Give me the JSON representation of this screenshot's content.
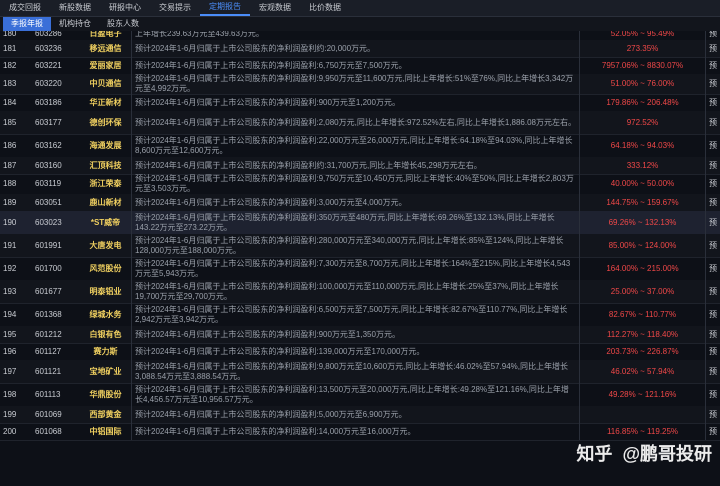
{
  "topnav": {
    "tabs": [
      "成交回报",
      "新股数据",
      "研报中心",
      "交易提示",
      "定期报告",
      "宏观数据",
      "比价数据"
    ],
    "active_index": 4
  },
  "subnav": {
    "tabs": [
      "季报年报",
      "机构持仓",
      "股东人数"
    ],
    "active_index": 0
  },
  "rows": [
    {
      "idx": "180",
      "code": "603286",
      "name": "日盈电子",
      "desc": "上年增长239.63万元至439.63万元。",
      "range": "52.05% ~ 95.49%",
      "type": "预"
    },
    {
      "idx": "181",
      "code": "603236",
      "name": "移远通信",
      "desc": "预计2024年1-6月归属于上市公司股东的净利润盈利约:20,000万元。",
      "range": "273.35%",
      "type": "预"
    },
    {
      "idx": "182",
      "code": "603221",
      "name": "爱丽家居",
      "desc": "预计2024年1-6月归属于上市公司股东的净利润盈利:6,750万元至7,500万元。",
      "range": "7957.06% ~ 8830.07%",
      "type": "预"
    },
    {
      "idx": "183",
      "code": "603220",
      "name": "中贝通信",
      "desc": "预计2024年1-6月归属于上市公司股东的净利润盈利:9,950万元至11,600万元,同比上年增长:51%至76%,同比上年增长3,342万元至4,992万元。",
      "range": "51.00% ~ 76.00%",
      "type": "预"
    },
    {
      "idx": "184",
      "code": "603186",
      "name": "华正新材",
      "desc": "预计2024年1-6月归属于上市公司股东的净利润盈利:900万元至1,200万元。",
      "range": "179.86% ~ 206.48%",
      "type": "预"
    },
    {
      "idx": "185",
      "code": "603177",
      "name": "德创环保",
      "desc": "预计2024年1-6月归属于上市公司股东的净利润盈利:2,080万元,同比上年增长:972.52%左右,同比上年增长1,886.08万元左右。",
      "range": "972.52%",
      "type": "预"
    },
    {
      "idx": "186",
      "code": "603162",
      "name": "海通发展",
      "desc": "预计2024年1-6月归属于上市公司股东的净利润盈利:22,000万元至26,000万元,同比上年增长:64.18%至94.03%,同比上年增长8,600万元至12,600万元。",
      "range": "64.18% ~ 94.03%",
      "type": "预"
    },
    {
      "idx": "187",
      "code": "603160",
      "name": "汇顶科技",
      "desc": "预计2024年1-6月归属于上市公司股东的净利润盈利约:31,700万元,同比上年增长45,298万元左右。",
      "range": "333.12%",
      "type": "预"
    },
    {
      "idx": "188",
      "code": "603119",
      "name": "浙江荣泰",
      "desc": "预计2024年1-6月归属于上市公司股东的净利润盈利:9,750万元至10,450万元,同比上年增长:40%至50%,同比上年增长2,803万元至3,503万元。",
      "range": "40.00% ~ 50.00%",
      "type": "预"
    },
    {
      "idx": "189",
      "code": "603051",
      "name": "鹿山新材",
      "desc": "预计2024年1-6月归属于上市公司股东的净利润盈利:3,000万元至4,000万元。",
      "range": "144.75% ~ 159.67%",
      "type": "预"
    },
    {
      "idx": "190",
      "code": "603023",
      "name": "*ST威帝",
      "desc": "预计2024年1-6月归属于上市公司股东的净利润盈利:350万元至480万元,同比上年增长:69.26%至132.13%,同比上年增长143.22万元至273.22万元。",
      "range": "69.26% ~ 132.13%",
      "type": "预"
    },
    {
      "idx": "191",
      "code": "601991",
      "name": "大唐发电",
      "desc": "预计2024年1-6月归属于上市公司股东的净利润盈利:280,000万元至340,000万元,同比上年增长:85%至124%,同比上年增长128,000万元至188,000万元。",
      "range": "85.00% ~ 124.00%",
      "type": "预"
    },
    {
      "idx": "192",
      "code": "601700",
      "name": "风范股份",
      "desc": "预计2024年1-6月归属于上市公司股东的净利润盈利:7,300万元至8,700万元,同比上年增长:164%至215%,同比上年增长4,543万元至5,943万元。",
      "range": "164.00% ~ 215.00%",
      "type": "预"
    },
    {
      "idx": "193",
      "code": "601677",
      "name": "明泰铝业",
      "desc": "预计2024年1-6月归属于上市公司股东的净利润盈利:100,000万元至110,000万元,同比上年增长:25%至37%,同比上年增长19,700万元至29,700万元。",
      "range": "25.00% ~ 37.00%",
      "type": "预"
    },
    {
      "idx": "194",
      "code": "601368",
      "name": "绿城水务",
      "desc": "预计2024年1-6月归属于上市公司股东的净利润盈利:6,500万元至7,500万元,同比上年增长:82.67%至110.77%,同比上年增长2,942万元至3,942万元。",
      "range": "82.67% ~ 110.77%",
      "type": "预"
    },
    {
      "idx": "195",
      "code": "601212",
      "name": "白银有色",
      "desc": "预计2024年1-6月归属于上市公司股东的净利润盈利:900万元至1,350万元。",
      "range": "112.27% ~ 118.40%",
      "type": "预"
    },
    {
      "idx": "196",
      "code": "601127",
      "name": "赛力斯",
      "desc": "预计2024年1-6月归属于上市公司股东的净利润盈利:139,000万元至170,000万元。",
      "range": "203.73% ~ 226.87%",
      "type": "预"
    },
    {
      "idx": "197",
      "code": "601121",
      "name": "宝地矿业",
      "desc": "预计2024年1-6月归属于上市公司股东的净利润盈利:9,800万元至10,600万元,同比上年增长:46.02%至57.94%,同比上年增长3,088.54万元至3,888.54万元。",
      "range": "46.02% ~ 57.94%",
      "type": "预"
    },
    {
      "idx": "198",
      "code": "601113",
      "name": "华鼎股份",
      "desc": "预计2024年1-6月归属于上市公司股东的净利润盈利:13,500万元至20,000万元,同比上年增长:49.28%至121.16%,同比上年增长4,456.57万元至10,956.57万元。",
      "range": "49.28% ~ 121.16%",
      "type": "预"
    },
    {
      "idx": "199",
      "code": "601069",
      "name": "西部黄金",
      "desc": "预计2024年1-6月归属于上市公司股东的净利润盈利:5,000万元至6,900万元。",
      "range": "",
      "type": "预"
    },
    {
      "idx": "200",
      "code": "601068",
      "name": "中铝国际",
      "desc": "预计2024年1-6月归属于上市公司股东的净利润盈利:14,000万元至16,000万元。",
      "range": "116.85% ~ 119.25%",
      "type": "预"
    }
  ],
  "watermark": {
    "site": "知乎",
    "author": "@鹏哥投研"
  }
}
